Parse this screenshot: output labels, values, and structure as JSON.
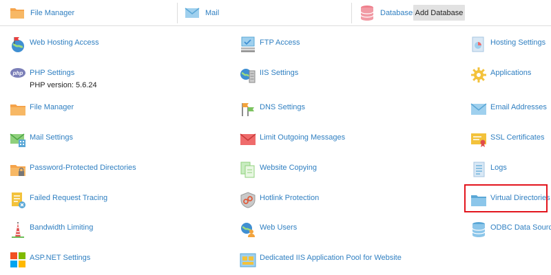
{
  "topbar": {
    "file_manager": "File Manager",
    "mail": "Mail",
    "databases": "Databases",
    "add_database": "Add Database"
  },
  "columns": [
    {
      "items": [
        {
          "id": "web-hosting-access",
          "label": "Web Hosting Access",
          "icon": "globe-flag-icon"
        },
        {
          "id": "php-settings",
          "label": "PHP Settings",
          "sub": "PHP version: 5.6.24",
          "icon": "php-icon"
        },
        {
          "id": "file-manager",
          "label": "File Manager",
          "icon": "folder-icon"
        },
        {
          "id": "mail-settings",
          "label": "Mail Settings",
          "icon": "mail-gear-icon"
        },
        {
          "id": "password-protected-directories",
          "label": "Password-Protected Directories",
          "icon": "folder-lock-icon"
        },
        {
          "id": "failed-request-tracing",
          "label": "Failed Request Tracing",
          "icon": "document-error-icon"
        },
        {
          "id": "bandwidth-limiting",
          "label": "Bandwidth Limiting",
          "icon": "tower-icon"
        },
        {
          "id": "aspnet-settings",
          "label": "ASP.NET Settings",
          "icon": "windows-logo-icon"
        }
      ]
    },
    {
      "items": [
        {
          "id": "ftp-access",
          "label": "FTP Access",
          "icon": "ftp-monitor-icon"
        },
        {
          "id": "iis-settings",
          "label": "IIS Settings",
          "icon": "globe-server-icon"
        },
        {
          "id": "dns-settings",
          "label": "DNS Settings",
          "icon": "dns-flags-icon"
        },
        {
          "id": "limit-outgoing-messages",
          "label": "Limit Outgoing Messages",
          "icon": "envelope-red-icon"
        },
        {
          "id": "website-copying",
          "label": "Website Copying",
          "icon": "copy-pages-icon"
        },
        {
          "id": "hotlink-protection",
          "label": "Hotlink Protection",
          "icon": "shield-link-icon"
        },
        {
          "id": "web-users",
          "label": "Web Users",
          "icon": "globe-user-icon"
        },
        {
          "id": "dedicated-iis-app-pool",
          "label": "Dedicated IIS Application Pool for Website",
          "icon": "app-pool-icon"
        }
      ]
    },
    {
      "items": [
        {
          "id": "hosting-settings",
          "label": "Hosting Settings",
          "icon": "document-chart-icon"
        },
        {
          "id": "applications",
          "label": "Applications",
          "icon": "gear-icon"
        },
        {
          "id": "email-addresses",
          "label": "Email Addresses",
          "icon": "envelope-icon"
        },
        {
          "id": "ssl-certificates",
          "label": "SSL Certificates",
          "icon": "certificate-icon"
        },
        {
          "id": "logs",
          "label": "Logs",
          "icon": "log-document-icon"
        },
        {
          "id": "virtual-directories",
          "label": "Virtual Directories",
          "icon": "folder-blue-icon"
        },
        {
          "id": "odbc-data-sources",
          "label": "ODBC Data Sources",
          "icon": "database-icon"
        }
      ]
    }
  ],
  "colors": {
    "link": "#2f7fc1",
    "highlight": "#e2141c",
    "folder": "#f5a34a"
  }
}
